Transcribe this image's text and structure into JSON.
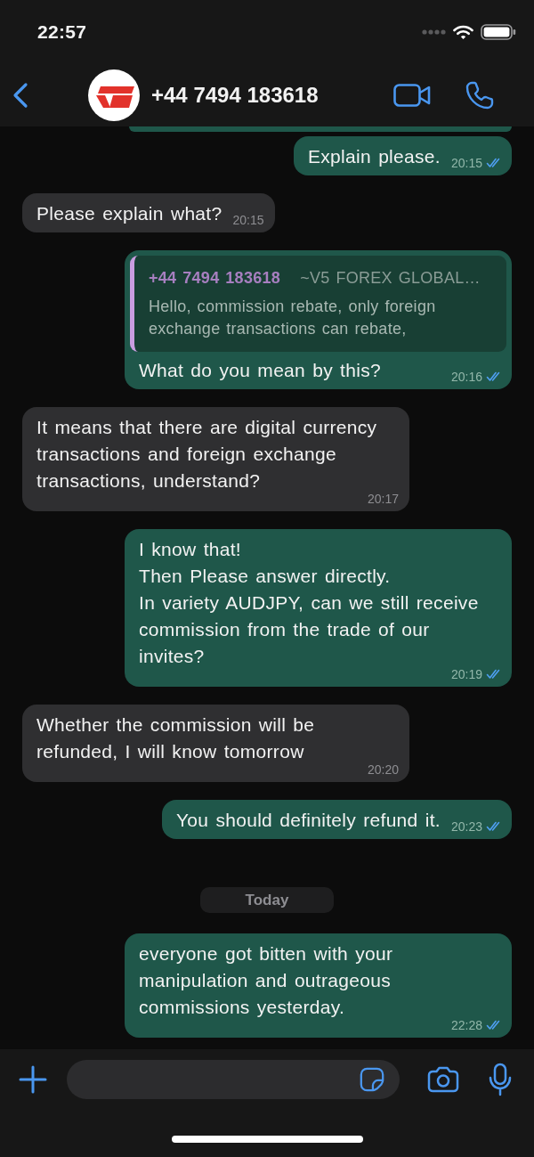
{
  "status_bar": {
    "time": "22:57"
  },
  "header": {
    "title": "+44 7494 183618"
  },
  "chat": {
    "messages": [
      {
        "kind": "outgoing",
        "text": "Explain please.",
        "time": "20:15",
        "read": true
      },
      {
        "kind": "incoming",
        "text": "Please explain what?",
        "time": "20:15"
      },
      {
        "kind": "outgoing",
        "quote": {
          "author": "+44 7494 183618",
          "source": "~V5 FOREX GLOBAL…",
          "text": "Hello, commission rebate, only foreign exchange transactions can rebate,"
        },
        "text": "What do you mean by this?",
        "time": "20:16",
        "read": true
      },
      {
        "kind": "incoming",
        "text": "It means that there are digital currency transactions and foreign exchange transactions, understand?",
        "time": "20:17"
      },
      {
        "kind": "outgoing",
        "text": "I know that!\nThen Please answer directly.\nIn variety AUDJPY, can we still receive commission from the trade of our invites?",
        "time": "20:19",
        "read": true
      },
      {
        "kind": "incoming",
        "text": "Whether the commission will be refunded, I will know tomorrow",
        "time": "20:20"
      },
      {
        "kind": "outgoing",
        "text": "You should definitely refund it.",
        "time": "20:23",
        "read": true
      },
      {
        "kind": "date",
        "text": "Today"
      },
      {
        "kind": "outgoing",
        "text": "everyone got bitten with your manipulation and outrageous commissions yesterday.",
        "time": "22:28",
        "read": true
      }
    ]
  }
}
